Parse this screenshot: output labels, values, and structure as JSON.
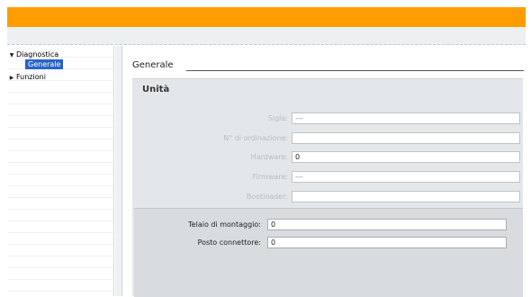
{
  "nav": {
    "items": [
      {
        "label": "Diagnostica",
        "expanded": true
      },
      {
        "label": "Generale",
        "selected": true
      },
      {
        "label": "Funzioni",
        "expanded": false
      }
    ]
  },
  "content": {
    "section_title": "Generale",
    "unit_panel": {
      "title": "Unità",
      "fields": [
        {
          "label": "Sigla:",
          "value": "---"
        },
        {
          "label": "N° di ordinazione:",
          "value": ""
        },
        {
          "label": "Hardware:",
          "value": "0"
        },
        {
          "label": "Firmware:",
          "value": "---"
        },
        {
          "label": "Bootloader:",
          "value": ""
        }
      ]
    },
    "mount_panel": {
      "fields": [
        {
          "label": "Telaio di montaggio:",
          "value": "0"
        },
        {
          "label": "Posto connettore:",
          "value": "0"
        }
      ]
    }
  },
  "colors": {
    "titlebar": "#ff9d00",
    "selection": "#2a63c6"
  }
}
